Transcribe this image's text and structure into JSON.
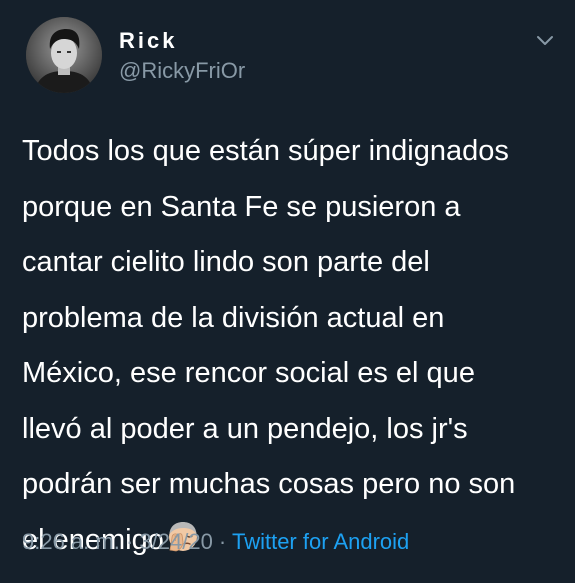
{
  "author": {
    "display_name": "Rick",
    "handle": "@RickyFriOr",
    "avatar_icon": "profile-photo"
  },
  "more_icon": "chevron-down-icon",
  "tweet": {
    "lines": [
      "Todos los que están súper indignados",
      "porque en Santa Fe se pusieron a",
      "cantar cielito lindo son parte del",
      "problema de la división actual en",
      "México, ese rencor social es el que",
      "llevó al poder a un pendejo, los jr's",
      "podrán ser muchas cosas pero no son",
      "el enemigo"
    ],
    "emoji": "face-palm-emoji"
  },
  "meta": {
    "time": "9:26 a. m.",
    "separator1": " · ",
    "date": "3/24/20",
    "separator2": " · ",
    "source": "Twitter for Android"
  },
  "colors": {
    "background": "#15202b",
    "primary_text": "#ffffff",
    "secondary_text": "#8899a6",
    "link": "#1da1f2"
  }
}
